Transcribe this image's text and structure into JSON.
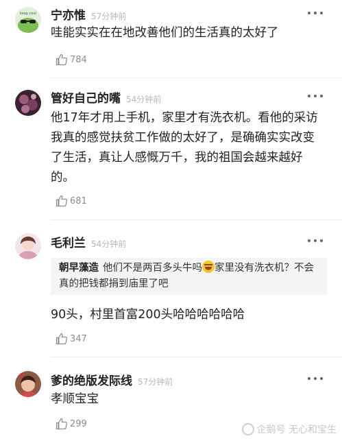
{
  "comments": [
    {
      "username": "宁亦惟",
      "time": "57分钟前",
      "text": "哇能实实在在地改善他们的生活真的太好了",
      "likes": "784",
      "avatar_text": "keep cool"
    },
    {
      "username": "管好自己的嘴",
      "time": "54分钟前",
      "text": "他17年才用上手机，家里才有洗衣机。看他的采访我真的感觉扶贫工作做的太好了，是确确实实改变了生活，真让人感慨万千，我的祖国会越来越好的。",
      "likes": "681"
    },
    {
      "username": "毛利兰",
      "time": "54分钟前",
      "quote_name": "朝早藻造",
      "quote_text_1": "他们不是两百多头牛吗",
      "quote_emoji": "laughing-tears-emoji",
      "quote_text_2": "家里没有洗衣机？不会真的把钱都捐到庙里了吧",
      "text": "90头，村里首富200头哈哈哈哈哈哈",
      "likes": "347"
    },
    {
      "username": "爹的绝版发际线",
      "time": "57分钟前",
      "text": "孝顺宝宝",
      "likes": "299"
    }
  ],
  "watermark": {
    "text": "企鹅号 无心和宝生"
  },
  "colors": {
    "text": "#222222",
    "meta": "#b8b8b8",
    "like": "#8c8c8c",
    "quote_bg": "#f4f4f4"
  }
}
